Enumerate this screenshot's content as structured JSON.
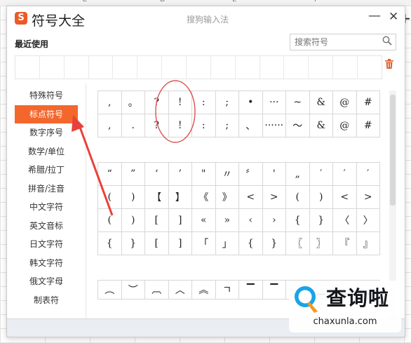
{
  "background": {
    "columns": [
      "C",
      "D",
      "E",
      "F"
    ],
    "plus_glyph": "+"
  },
  "dialog": {
    "title": "符号大全",
    "ime_name": "搜狗输入法",
    "logo_letter": "S",
    "minimize_glyph": "—",
    "close_glyph": "✕",
    "accent_color": "#f3672c"
  },
  "recent": {
    "label": "最近使用",
    "cells": 15
  },
  "search": {
    "placeholder": "搜索符号",
    "icon": "search-icon"
  },
  "sidebar": {
    "items": [
      {
        "label": "特殊符号",
        "active": false
      },
      {
        "label": "标点符号",
        "active": true
      },
      {
        "label": "数字序号",
        "active": false
      },
      {
        "label": "数学/单位",
        "active": false
      },
      {
        "label": "希腊/拉丁",
        "active": false
      },
      {
        "label": "拼音/注音",
        "active": false
      },
      {
        "label": "中文字符",
        "active": false
      },
      {
        "label": "英文音标",
        "active": false
      },
      {
        "label": "日文字符",
        "active": false
      },
      {
        "label": "韩文字符",
        "active": false
      },
      {
        "label": "俄文字母",
        "active": false
      },
      {
        "label": "制表符",
        "active": false
      }
    ]
  },
  "panels": [
    {
      "rows": [
        [
          ",",
          "。",
          "?",
          "!",
          ":",
          ";",
          "•",
          "···",
          "~",
          "&",
          "@",
          "#"
        ],
        [
          ",",
          ".",
          "?",
          "!",
          ":",
          ";",
          "、",
          "······",
          "〜",
          "&",
          "@",
          "#"
        ]
      ]
    },
    {
      "rows": [
        [
          "“",
          "”",
          "‘",
          "’",
          "\"",
          "〃",
          "〞",
          "'",
          "„",
          "′",
          "′",
          "′"
        ],
        [
          "(",
          ")",
          "【",
          "】",
          "《",
          "》",
          "<",
          ">",
          "(",
          ")",
          "<",
          ">"
        ],
        [
          "(",
          ")",
          "[",
          "]",
          "«",
          "»",
          "‹",
          "›",
          "{",
          "}",
          "〈",
          "〉"
        ],
        [
          "{",
          "}",
          "[",
          "]",
          "「",
          "」",
          "{",
          "}",
          "〖",
          "〗",
          "『",
          "』"
        ]
      ]
    },
    {
      "rows": [
        [
          "︵",
          "︶",
          "︹",
          "︿",
          "︽",
          "ㄱ",
          "▔",
          "▔",
          "▁",
          "▁",
          "▁",
          "▁"
        ]
      ]
    }
  ],
  "watermark": {
    "text": "查询啦",
    "domain": "chaxunla.com",
    "icon": "magnifier-logo-icon"
  },
  "annotation": {
    "highlighted_symbol": "!",
    "circle_color": "#d9534f",
    "arrow_color": "#e8413a"
  }
}
